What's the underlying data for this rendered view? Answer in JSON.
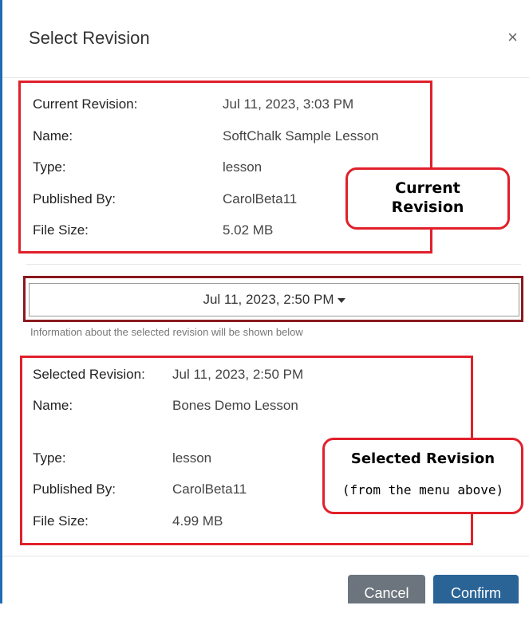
{
  "dialog": {
    "title": "Select Revision",
    "close_glyph": "×"
  },
  "current": {
    "rows": [
      {
        "label": "Current Revision:",
        "value": "Jul 11, 2023, 3:03 PM"
      },
      {
        "label": "Name:",
        "value": "SoftChalk Sample Lesson"
      },
      {
        "label": "Type:",
        "value": "lesson"
      },
      {
        "label": "Published By:",
        "value": "CarolBeta11"
      },
      {
        "label": "File Size:",
        "value": "5.02 MB"
      }
    ],
    "callout_line1": "Current",
    "callout_line2": "Revision"
  },
  "selector": {
    "selected_value": "Jul 11, 2023, 2:50 PM",
    "helper_text": "Information about the selected revision will be shown below"
  },
  "selected": {
    "rows": [
      {
        "label": "Selected Revision:",
        "value": "Jul 11, 2023, 2:50 PM"
      },
      {
        "label": "Name:",
        "value": "Bones Demo Lesson"
      },
      {
        "label": "Type:",
        "value": "lesson"
      },
      {
        "label": "Published By:",
        "value": "CarolBeta11"
      },
      {
        "label": "File Size:",
        "value": "4.99 MB"
      }
    ],
    "callout_title": "Selected Revision",
    "callout_subtitle": "(from the menu above)"
  },
  "footer": {
    "cancel_label": "Cancel",
    "confirm_label": "Confirm"
  },
  "colors": {
    "annotation_red": "#e0202a",
    "selector_outline": "#8a1a1e",
    "cancel_bg": "#6c757d",
    "confirm_bg": "#2a6497"
  }
}
